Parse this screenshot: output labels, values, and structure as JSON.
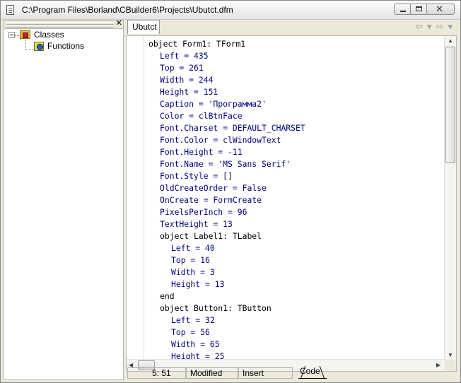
{
  "window": {
    "title": "C:\\Program Files\\Borland\\CBuilder6\\Projects\\Ubutct.dfm",
    "close_glyph": "✕"
  },
  "tree": {
    "items": [
      {
        "label": "Classes",
        "icon": "classes-folder-icon"
      },
      {
        "label": "Functions",
        "icon": "functions-icon"
      }
    ],
    "close_glyph": "✕"
  },
  "tabs": [
    {
      "label": "Ubutct",
      "active": true
    }
  ],
  "nav": {
    "back": "⇦",
    "back_drop": "▾",
    "forward": "⇨",
    "forward_drop": "▾"
  },
  "editor": {
    "lines": [
      {
        "indent": 0,
        "text": "object Form1: TForm1",
        "kw": true
      },
      {
        "indent": 1,
        "text": "Left = 435"
      },
      {
        "indent": 1,
        "text": "Top = 261"
      },
      {
        "indent": 1,
        "text": "Width = 244"
      },
      {
        "indent": 1,
        "text": "Height = 151"
      },
      {
        "indent": 1,
        "text": "Caption = 'Программа2'"
      },
      {
        "indent": 1,
        "text": "Color = clBtnFace"
      },
      {
        "indent": 1,
        "text": "Font.Charset = DEFAULT_CHARSET"
      },
      {
        "indent": 1,
        "text": "Font.Color = clWindowText"
      },
      {
        "indent": 1,
        "text": "Font.Height = -11"
      },
      {
        "indent": 1,
        "text": "Font.Name = 'MS Sans Serif'"
      },
      {
        "indent": 1,
        "text": "Font.Style = []"
      },
      {
        "indent": 1,
        "text": "OldCreateOrder = False"
      },
      {
        "indent": 1,
        "text": "OnCreate = FormCreate"
      },
      {
        "indent": 1,
        "text": "PixelsPerInch = 96"
      },
      {
        "indent": 1,
        "text": "TextHeight = 13"
      },
      {
        "indent": 1,
        "text": "object Label1: TLabel",
        "kw": true
      },
      {
        "indent": 2,
        "text": "Left = 40"
      },
      {
        "indent": 2,
        "text": "Top = 16"
      },
      {
        "indent": 2,
        "text": "Width = 3"
      },
      {
        "indent": 2,
        "text": "Height = 13"
      },
      {
        "indent": 1,
        "text": "end",
        "kw": true
      },
      {
        "indent": 1,
        "text": "object Button1: TButton",
        "kw": true
      },
      {
        "indent": 2,
        "text": "Left = 32"
      },
      {
        "indent": 2,
        "text": "Top = 56"
      },
      {
        "indent": 2,
        "text": "Width = 65"
      },
      {
        "indent": 2,
        "text": "Height = 25"
      }
    ],
    "scroll_up": "▲",
    "scroll_down": "▼",
    "scroll_left": "◀",
    "scroll_right": "▶"
  },
  "status": {
    "position": "5:  51",
    "modified": "Modified",
    "mode": "Insert",
    "code_tab": "Code"
  },
  "colors": {
    "keyword": "#000000",
    "text": "#000080"
  }
}
